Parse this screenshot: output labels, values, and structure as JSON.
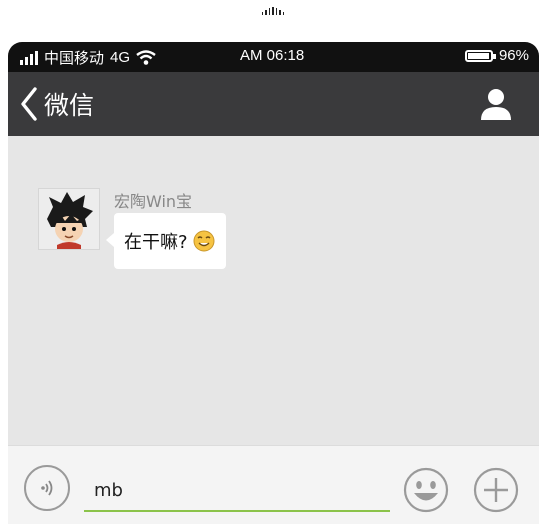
{
  "status_bar": {
    "carrier": "中国移动",
    "network": "4G",
    "time": "AM 06:18",
    "battery_text": "96%",
    "battery_level": 0.96
  },
  "nav": {
    "title": "微信"
  },
  "chat": {
    "messages": [
      {
        "sender": "宏陶Win宝",
        "text": "在干嘛?",
        "emoji": "smiling-face-icon"
      }
    ]
  },
  "input": {
    "value": "mb",
    "placeholder": ""
  },
  "colors": {
    "nav_bg": "#3a3a3c",
    "status_bg": "#111111",
    "chat_bg": "#e6e6e6",
    "input_underline": "#8bc34a"
  }
}
